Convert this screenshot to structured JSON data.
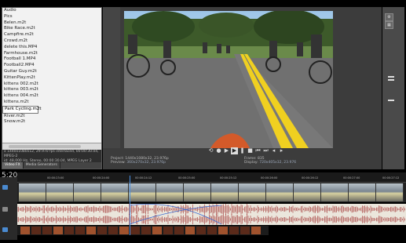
{
  "explorer": {
    "files": [
      "Audio",
      "Pics",
      "Belen.m2t",
      "Bike Race.m2t",
      "Campfire.m2t",
      "Crowd.m2t",
      "delete this.MP4",
      "Farmhouse.m2t",
      "Football 1.MP4",
      "Football2.MP4",
      "Guitar Guy.m2t",
      "KittenPlay.m2t",
      "kittens 002.m2t",
      "kittens 003.m2t",
      "kittens 004.m2t",
      "kittens.m2t",
      "Park Cycling.m2t",
      "River.m2t",
      "Snow.m2t"
    ],
    "selected_index": 16,
    "info_line1": "x 1440x1080x12, 29.970 fps interlaced, 00:00:30.04, MPEG-2",
    "info_line2": "id: 48,000 Hz, Stereo, 00:00:30.04, MPEG Layer 2",
    "tabs": [
      "Video FX",
      "Media Generators"
    ]
  },
  "preview": {
    "project_label": "Project:",
    "project_value": "1440x1080x32, 23.976p",
    "preview_label": "Preview:",
    "preview_value": "360x270x32, 23.976p",
    "frame_label": "Frame:",
    "frame_value": "835",
    "display_label": "Display:",
    "display_value": "720x405x32, 23.976"
  },
  "timeline": {
    "timecode": "5:20",
    "ticks": [
      "00:00:23:00",
      "00:00:24:00",
      "00:00:24:12",
      "00:00:25:00",
      "00:00:25:12",
      "00:00:26:00",
      "00:00:26:12",
      "00:00:27:00",
      "00:00:27:12"
    ]
  },
  "colors": {
    "accent": "#4a90e2",
    "audio_wave": "#a03030",
    "road": "#6e6e6e",
    "line": "#f0d020"
  }
}
